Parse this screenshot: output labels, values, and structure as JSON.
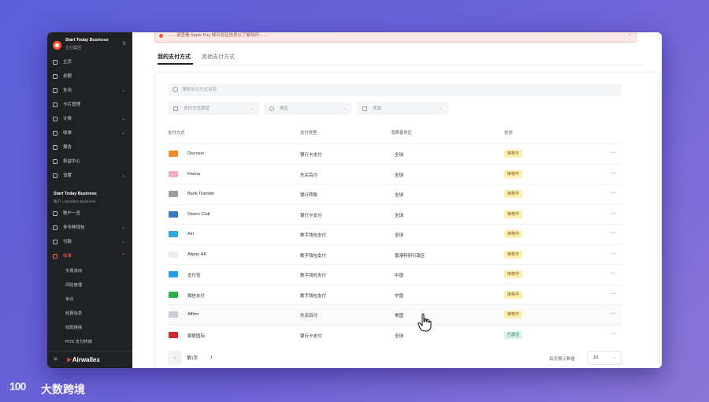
{
  "sidebar": {
    "workspace": {
      "name": "Start Today Business",
      "sub": "企业集团"
    },
    "nav": [
      {
        "label": "主页",
        "icon": "home-icon",
        "chevron": ""
      },
      {
        "label": "余额",
        "icon": "bank-icon",
        "chevron": ""
      },
      {
        "label": "支出",
        "icon": "wallet-icon",
        "chevron": "⌄"
      },
      {
        "label": "卡片管理",
        "icon": "card-icon",
        "chevron": ""
      },
      {
        "label": "计费",
        "icon": "bill-icon",
        "chevron": "⌄"
      },
      {
        "label": "收单",
        "icon": "cart-icon",
        "chevron": "⌄"
      },
      {
        "label": "报告",
        "icon": "report-icon",
        "chevron": ""
      },
      {
        "label": "权益中心",
        "icon": "gift-icon",
        "chevron": ""
      },
      {
        "label": "设置",
        "icon": "gear-icon",
        "chevron": "⌄"
      }
    ],
    "account": {
      "name": "Start Today Business",
      "sub": "账户 | Sandbox Business"
    },
    "account_nav": [
      {
        "label": "账户一览",
        "icon": "list-icon",
        "chevron": ""
      },
      {
        "label": "多币种钱包",
        "icon": "wallet-icon",
        "chevron": "⌄"
      },
      {
        "label": "付款",
        "icon": "transfer-icon",
        "chevron": "⌄"
      },
      {
        "label": "收单",
        "icon": "cart-icon",
        "chevron": "⌃"
      }
    ],
    "sub_items": [
      "交易流动",
      "风险管理",
      "争议",
      "结算信息",
      "收款链接",
      "POS 支付终端"
    ],
    "brand": "Airwallex",
    "accent": "#ff5a36"
  },
  "alert": {
    "text": "……请查看 Apple Pay 域名验证信息以了解如何……",
    "close": "×"
  },
  "tabs": [
    "我的支付方式",
    "其他支付方式"
  ],
  "search": {
    "placeholder": "搜索支付方式名称"
  },
  "filters": [
    {
      "label": "支付方式类型",
      "icon": "tag-icon"
    },
    {
      "label": "地区",
      "icon": "location-icon"
    },
    {
      "label": "状态",
      "icon": "folder-icon"
    }
  ],
  "table": {
    "headers": [
      "支付方式",
      "支付类型",
      "消费者地区",
      "状态"
    ],
    "rows": [
      {
        "name": "Discover",
        "type": "银行卡支付",
        "region": "全球",
        "status": "审核中",
        "status_kind": "review",
        "logo_color": "#f08a24"
      },
      {
        "name": "Klarna",
        "type": "先买后付",
        "region": "全球",
        "status": "审核中",
        "status_kind": "review",
        "logo_color": "#f5a9c8"
      },
      {
        "name": "Bank Transfer",
        "type": "银行转账",
        "region": "全球",
        "status": "审核中",
        "status_kind": "review",
        "logo_color": "#9a9ca2"
      },
      {
        "name": "Diners Club",
        "type": "银行卡支付",
        "region": "全球",
        "status": "审核中",
        "status_kind": "review",
        "logo_color": "#3a78c8"
      },
      {
        "name": "Airi",
        "type": "数字钱包支付",
        "region": "全球",
        "status": "审核中",
        "status_kind": "review",
        "logo_color": "#2fa8e0"
      },
      {
        "name": "Alipay HK",
        "type": "数字钱包支付",
        "region": "香港特别行政区",
        "status": "审核中",
        "status_kind": "review",
        "logo_color": "#e8ecf2"
      },
      {
        "name": "支付宝",
        "type": "数字钱包支付",
        "region": "中国",
        "status": "审核中",
        "status_kind": "review",
        "logo_color": "#1e9fe6"
      },
      {
        "name": "微信支付",
        "type": "数字钱包支付",
        "region": "中国",
        "status": "审核中",
        "status_kind": "review",
        "logo_color": "#2bb24c"
      },
      {
        "name": "Affirm",
        "type": "先买后付",
        "region": "美国",
        "status": "审核中",
        "status_kind": "review",
        "logo_color": "#c9ccd2"
      },
      {
        "name": "银联国际",
        "type": "银行卡支付",
        "region": "全球",
        "status": "已激活",
        "status_kind": "ok",
        "logo_color": "#d8262e"
      }
    ],
    "more": "···"
  },
  "pagination": {
    "prev": "‹",
    "page_label": "第1页",
    "next": "›",
    "per_page_label": "每页展示数量",
    "per_page": "10",
    "chevron": "⌄"
  },
  "watermark": {
    "logo": "100",
    "text": "大数跨境"
  }
}
